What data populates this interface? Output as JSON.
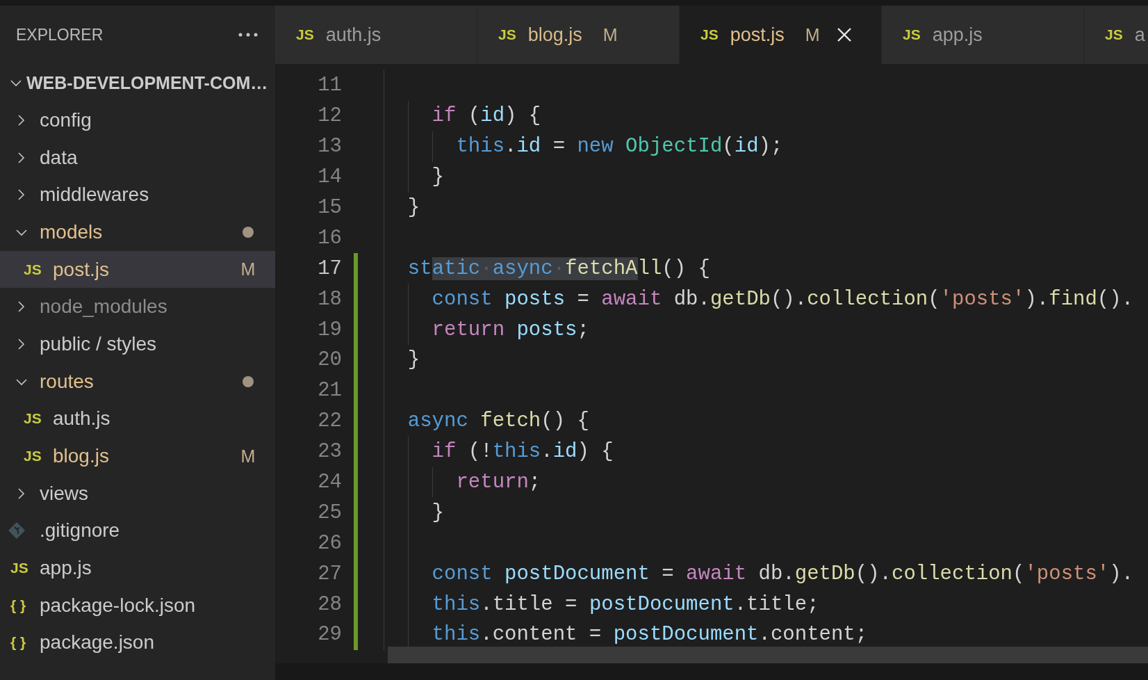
{
  "explorer": {
    "title": "EXPLORER",
    "root": {
      "label": "WEB-DEVELOPMENT-COM…",
      "expanded": true,
      "children": [
        {
          "kind": "folder",
          "label": "config",
          "expanded": false,
          "modified": false,
          "ignored": false,
          "selected": false
        },
        {
          "kind": "folder",
          "label": "data",
          "expanded": false,
          "modified": false,
          "ignored": false,
          "selected": false
        },
        {
          "kind": "folder",
          "label": "middlewares",
          "expanded": false,
          "modified": false,
          "ignored": false,
          "selected": false
        },
        {
          "kind": "folder",
          "label": "models",
          "expanded": true,
          "modified": true,
          "ignored": false,
          "selected": false,
          "children": [
            {
              "kind": "js-file",
              "icon": "JS",
              "label": "post.js",
              "badge": "M",
              "modified": true,
              "ignored": false,
              "selected": true
            }
          ]
        },
        {
          "kind": "folder",
          "label": "node_modules",
          "expanded": false,
          "modified": false,
          "ignored": true,
          "selected": false
        },
        {
          "kind": "folder",
          "label": "public / styles",
          "expanded": false,
          "modified": false,
          "ignored": false,
          "selected": false
        },
        {
          "kind": "folder",
          "label": "routes",
          "expanded": true,
          "modified": true,
          "ignored": false,
          "selected": false,
          "children": [
            {
              "kind": "js-file",
              "icon": "JS",
              "label": "auth.js",
              "modified": false,
              "ignored": false,
              "selected": false
            },
            {
              "kind": "js-file",
              "icon": "JS",
              "label": "blog.js",
              "badge": "M",
              "modified": true,
              "ignored": false,
              "selected": false
            }
          ]
        },
        {
          "kind": "folder",
          "label": "views",
          "expanded": false,
          "modified": false,
          "ignored": false,
          "selected": false
        },
        {
          "kind": "git-file",
          "label": ".gitignore",
          "modified": false,
          "ignored": false,
          "selected": false
        },
        {
          "kind": "js-file",
          "icon": "JS",
          "label": "app.js",
          "modified": false,
          "ignored": false,
          "selected": false
        },
        {
          "kind": "json-file",
          "icon": "{ }",
          "label": "package-lock.json",
          "modified": false,
          "ignored": false,
          "selected": false
        },
        {
          "kind": "json-file",
          "icon": "{ }",
          "label": "package.json",
          "modified": false,
          "ignored": false,
          "selected": false
        }
      ]
    }
  },
  "tabs": [
    {
      "icon": "JS",
      "label": "auth.js",
      "modified": false,
      "selected": false
    },
    {
      "icon": "JS",
      "label": "blog.js",
      "badge": "M",
      "modified": true,
      "selected": false
    },
    {
      "icon": "JS",
      "label": "post.js",
      "badge": "M",
      "modified": true,
      "selected": true
    },
    {
      "icon": "JS",
      "label": "app.js",
      "modified": false,
      "selected": false
    },
    {
      "icon": "JS",
      "label": "a",
      "modified": false,
      "selected": false
    }
  ],
  "editor": {
    "lines": [
      {
        "number": "11",
        "modified": false,
        "current": false
      },
      {
        "number": "12",
        "modified": false,
        "current": false,
        "tokens": [
          {
            "kind": "keyword",
            "s": "    if"
          },
          {
            "kind": "plain",
            "s": " ("
          },
          {
            "kind": "variable",
            "s": "id"
          },
          {
            "kind": "plain",
            "s": ") {"
          }
        ]
      },
      {
        "number": "13",
        "modified": false,
        "current": false,
        "tokens": [
          {
            "kind": "storage",
            "s": "      this"
          },
          {
            "kind": "plain",
            "s": "."
          },
          {
            "kind": "variable",
            "s": "id"
          },
          {
            "kind": "plain",
            "s": " = "
          },
          {
            "kind": "storage",
            "s": "new"
          },
          {
            "kind": "class",
            "s": " ObjectId"
          },
          {
            "kind": "plain",
            "s": "("
          },
          {
            "kind": "variable",
            "s": "id"
          },
          {
            "kind": "plain",
            "s": ");"
          }
        ]
      },
      {
        "number": "14",
        "modified": false,
        "current": false,
        "tokens": [
          {
            "kind": "plain",
            "s": "    }"
          }
        ]
      },
      {
        "number": "15",
        "modified": false,
        "current": false,
        "tokens": [
          {
            "kind": "plain",
            "s": "  }"
          }
        ]
      },
      {
        "number": "16",
        "modified": false,
        "current": false
      },
      {
        "number": "17",
        "modified": true,
        "current": true,
        "tokens": [
          {
            "kind": "storage",
            "s": "  st"
          },
          {
            "kind": "storage",
            "s": "atic",
            "selected": true
          },
          {
            "kind": "whitespace",
            "s": "·",
            "selected": true
          },
          {
            "kind": "storage",
            "s": "async",
            "selected": true
          },
          {
            "kind": "whitespace",
            "s": "·",
            "selected": true
          },
          {
            "kind": "function",
            "s": "fetchA",
            "selected": true
          },
          {
            "kind": "function",
            "s": "ll"
          },
          {
            "kind": "plain",
            "s": "() {"
          }
        ]
      },
      {
        "number": "18",
        "modified": true,
        "current": false,
        "tokens": [
          {
            "kind": "storage",
            "s": "    const"
          },
          {
            "kind": "variable",
            "s": " posts"
          },
          {
            "kind": "plain",
            "s": " = "
          },
          {
            "kind": "keyword",
            "s": "await"
          },
          {
            "kind": "plain",
            "s": " db."
          },
          {
            "kind": "function",
            "s": "getDb"
          },
          {
            "kind": "plain",
            "s": "()."
          },
          {
            "kind": "function",
            "s": "collection"
          },
          {
            "kind": "plain",
            "s": "("
          },
          {
            "kind": "string",
            "s": "'posts'"
          },
          {
            "kind": "plain",
            "s": ")."
          },
          {
            "kind": "function",
            "s": "find"
          },
          {
            "kind": "plain",
            "s": "()."
          }
        ]
      },
      {
        "number": "19",
        "modified": true,
        "current": false,
        "tokens": [
          {
            "kind": "keyword",
            "s": "    return"
          },
          {
            "kind": "variable",
            "s": " posts"
          },
          {
            "kind": "plain",
            "s": ";"
          }
        ]
      },
      {
        "number": "20",
        "modified": true,
        "current": false,
        "tokens": [
          {
            "kind": "plain",
            "s": "  }"
          }
        ]
      },
      {
        "number": "21",
        "modified": true,
        "current": false
      },
      {
        "number": "22",
        "modified": true,
        "current": false,
        "tokens": [
          {
            "kind": "storage",
            "s": "  async"
          },
          {
            "kind": "function",
            "s": " fetch"
          },
          {
            "kind": "plain",
            "s": "() {"
          }
        ]
      },
      {
        "number": "23",
        "modified": true,
        "current": false,
        "tokens": [
          {
            "kind": "keyword",
            "s": "    if"
          },
          {
            "kind": "plain",
            "s": " (!"
          },
          {
            "kind": "storage",
            "s": "this"
          },
          {
            "kind": "plain",
            "s": "."
          },
          {
            "kind": "variable",
            "s": "id"
          },
          {
            "kind": "plain",
            "s": ") {"
          }
        ]
      },
      {
        "number": "24",
        "modified": true,
        "current": false,
        "tokens": [
          {
            "kind": "keyword",
            "s": "      return"
          },
          {
            "kind": "plain",
            "s": ";"
          }
        ]
      },
      {
        "number": "25",
        "modified": true,
        "current": false,
        "tokens": [
          {
            "kind": "plain",
            "s": "    }"
          }
        ]
      },
      {
        "number": "26",
        "modified": true,
        "current": false
      },
      {
        "number": "27",
        "modified": true,
        "current": false,
        "tokens": [
          {
            "kind": "storage",
            "s": "    const"
          },
          {
            "kind": "variable",
            "s": " postDocument"
          },
          {
            "kind": "plain",
            "s": " = "
          },
          {
            "kind": "keyword",
            "s": "await"
          },
          {
            "kind": "plain",
            "s": " db."
          },
          {
            "kind": "function",
            "s": "getDb"
          },
          {
            "kind": "plain",
            "s": "()."
          },
          {
            "kind": "function",
            "s": "collection"
          },
          {
            "kind": "plain",
            "s": "("
          },
          {
            "kind": "string",
            "s": "'posts'"
          },
          {
            "kind": "plain",
            "s": ")."
          }
        ]
      },
      {
        "number": "28",
        "modified": true,
        "current": false,
        "tokens": [
          {
            "kind": "storage",
            "s": "    this"
          },
          {
            "kind": "plain",
            "s": ".title = "
          },
          {
            "kind": "variable",
            "s": "postDocument"
          },
          {
            "kind": "plain",
            "s": ".title;"
          }
        ]
      },
      {
        "number": "29",
        "modified": true,
        "current": false,
        "tokens": [
          {
            "kind": "storage",
            "s": "    this"
          },
          {
            "kind": "plain",
            "s": ".content = "
          },
          {
            "kind": "variable",
            "s": "postDocument"
          },
          {
            "kind": "plain",
            "s": ".content;"
          }
        ]
      }
    ]
  }
}
